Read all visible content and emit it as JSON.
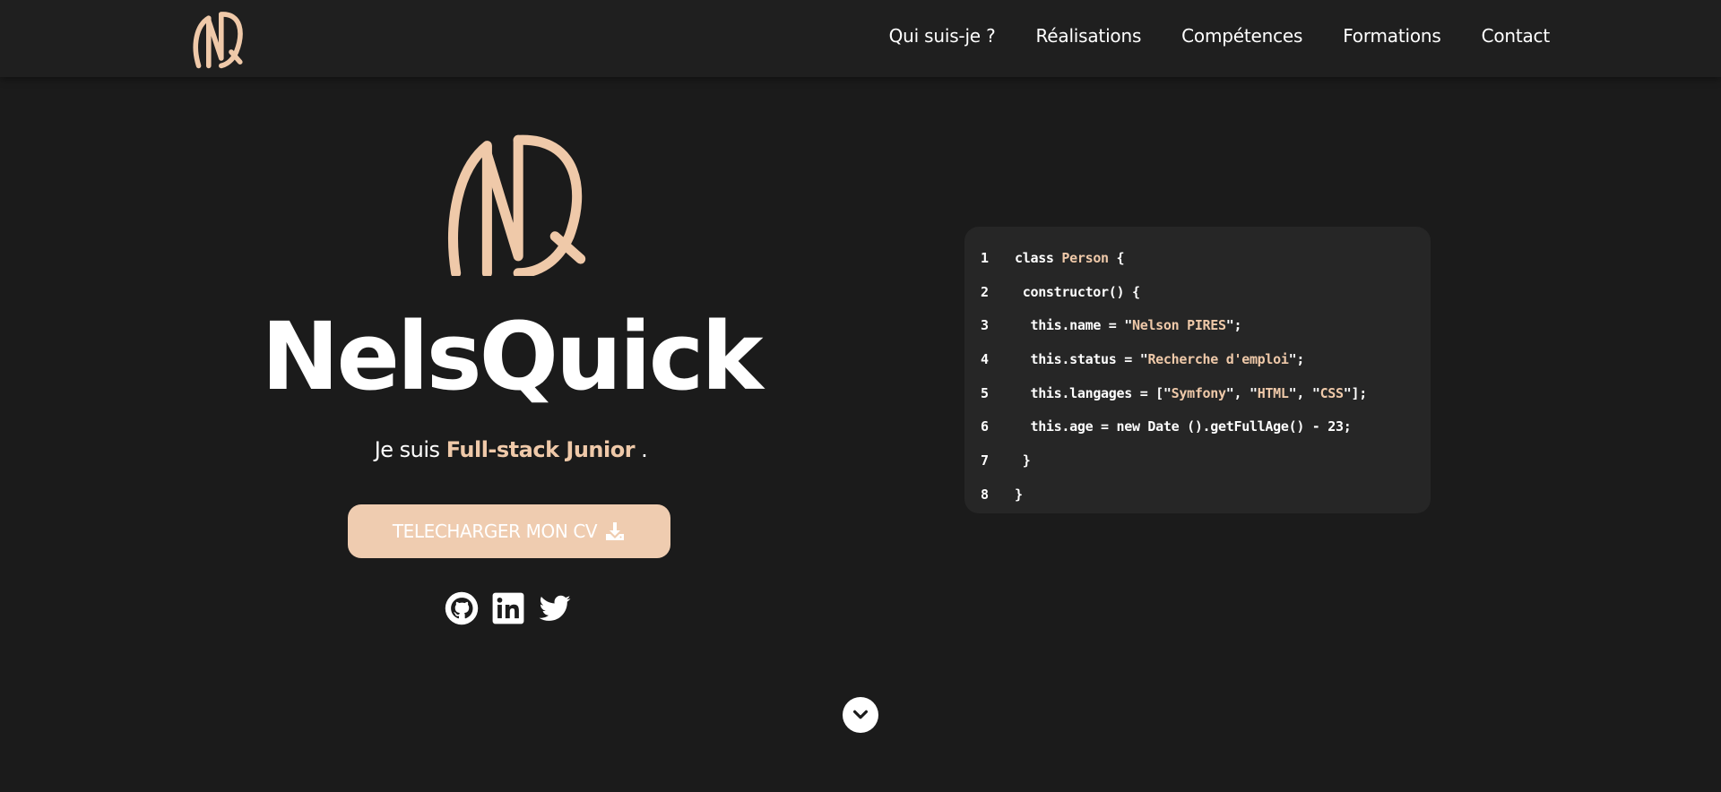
{
  "brand": {
    "logo_icon": "nq-monogram-logo",
    "accent_color": "#efc9a9",
    "button_color": "#efccb0",
    "background": "#1b1b1b"
  },
  "nav": {
    "items": [
      {
        "label": "Qui suis-je ?"
      },
      {
        "label": "Réalisations"
      },
      {
        "label": "Compétences"
      },
      {
        "label": "Formations"
      },
      {
        "label": "Contact"
      }
    ]
  },
  "hero": {
    "title": "NelsQuick",
    "subtitle_prefix": "Je suis ",
    "subtitle_highlight": "Full-stack Junior",
    "subtitle_suffix": " .",
    "cv_button": {
      "label": "TELECHARGER MON CV",
      "icon": "download-icon"
    },
    "socials": [
      {
        "name": "github-icon"
      },
      {
        "name": "linkedin-icon"
      },
      {
        "name": "twitter-icon"
      }
    ]
  },
  "code": {
    "lines": [
      {
        "num": "1",
        "indent": "",
        "parts": [
          {
            "t": "class "
          },
          {
            "t": "Person",
            "hl": true
          },
          {
            "t": " {"
          }
        ]
      },
      {
        "num": "2",
        "indent": " ",
        "parts": [
          {
            "t": "constructor() {"
          }
        ]
      },
      {
        "num": "3",
        "indent": "  ",
        "parts": [
          {
            "t": "this.name = \""
          },
          {
            "t": "Nelson PIRES",
            "hl": true
          },
          {
            "t": "\";"
          }
        ]
      },
      {
        "num": "4",
        "indent": "  ",
        "parts": [
          {
            "t": "this.status = \""
          },
          {
            "t": "Recherche d'emploi",
            "hl": true
          },
          {
            "t": "\";"
          }
        ]
      },
      {
        "num": "5",
        "indent": "  ",
        "parts": [
          {
            "t": "this.langages = [\""
          },
          {
            "t": "Symfony",
            "hl": true
          },
          {
            "t": "\", \""
          },
          {
            "t": "HTML",
            "hl": true
          },
          {
            "t": "\", \""
          },
          {
            "t": "CSS",
            "hl": true
          },
          {
            "t": "\"];"
          }
        ]
      },
      {
        "num": "6",
        "indent": "  ",
        "parts": [
          {
            "t": "this.age = new Date ().getFullAge() - 23;"
          }
        ]
      },
      {
        "num": "7",
        "indent": " ",
        "parts": [
          {
            "t": "}"
          }
        ]
      },
      {
        "num": "8",
        "indent": "",
        "parts": [
          {
            "t": "}"
          }
        ]
      }
    ]
  },
  "scroll_down": {
    "icon": "chevron-down-icon"
  }
}
